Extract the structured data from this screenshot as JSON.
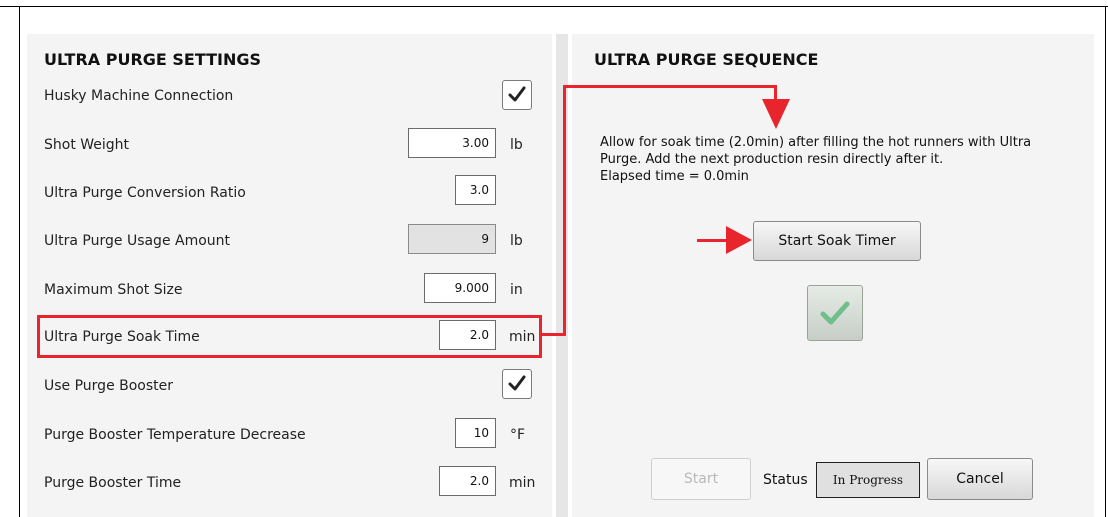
{
  "settings": {
    "title": "ULTRA PURGE SETTINGS",
    "rows": [
      {
        "label": "Husky Machine Connection",
        "type": "checkbox",
        "checked": true
      },
      {
        "label": "Shot Weight",
        "value": "3.00",
        "unit": "lb"
      },
      {
        "label": "Ultra Purge Conversion Ratio",
        "value": "3.0",
        "unit": ""
      },
      {
        "label": "Ultra Purge Usage Amount",
        "value": "9",
        "unit": "lb",
        "readonly": true
      },
      {
        "label": "Maximum Shot Size",
        "value": "9.000",
        "unit": "in"
      },
      {
        "label": "Ultra Purge Soak Time",
        "value": "2.0",
        "unit": "min",
        "highlighted": true
      },
      {
        "label": "Use Purge Booster",
        "type": "checkbox",
        "checked": true
      },
      {
        "label": "Purge Booster Temperature Decrease",
        "value": "10",
        "unit": "°F"
      },
      {
        "label": "Purge Booster Time",
        "value": "2.0",
        "unit": "min"
      }
    ]
  },
  "sequence": {
    "title": "ULTRA PURGE SEQUENCE",
    "message_line1": "Allow for soak time (2.0min) after filling the hot runners with Ultra",
    "message_line2": "Purge. Add the next production resin directly after it.",
    "message_line3": "Elapsed time = 0.0min",
    "start_soak_label": "Start Soak Timer",
    "soak_done_icon": "checkmark-icon",
    "start_label": "Start",
    "start_enabled": false,
    "status_label": "Status",
    "status_value": "In Progress",
    "cancel_label": "Cancel"
  },
  "colors": {
    "annotation": "#e8242d",
    "panel": "#f4f4f4",
    "check_green": "#6fbf8a"
  }
}
